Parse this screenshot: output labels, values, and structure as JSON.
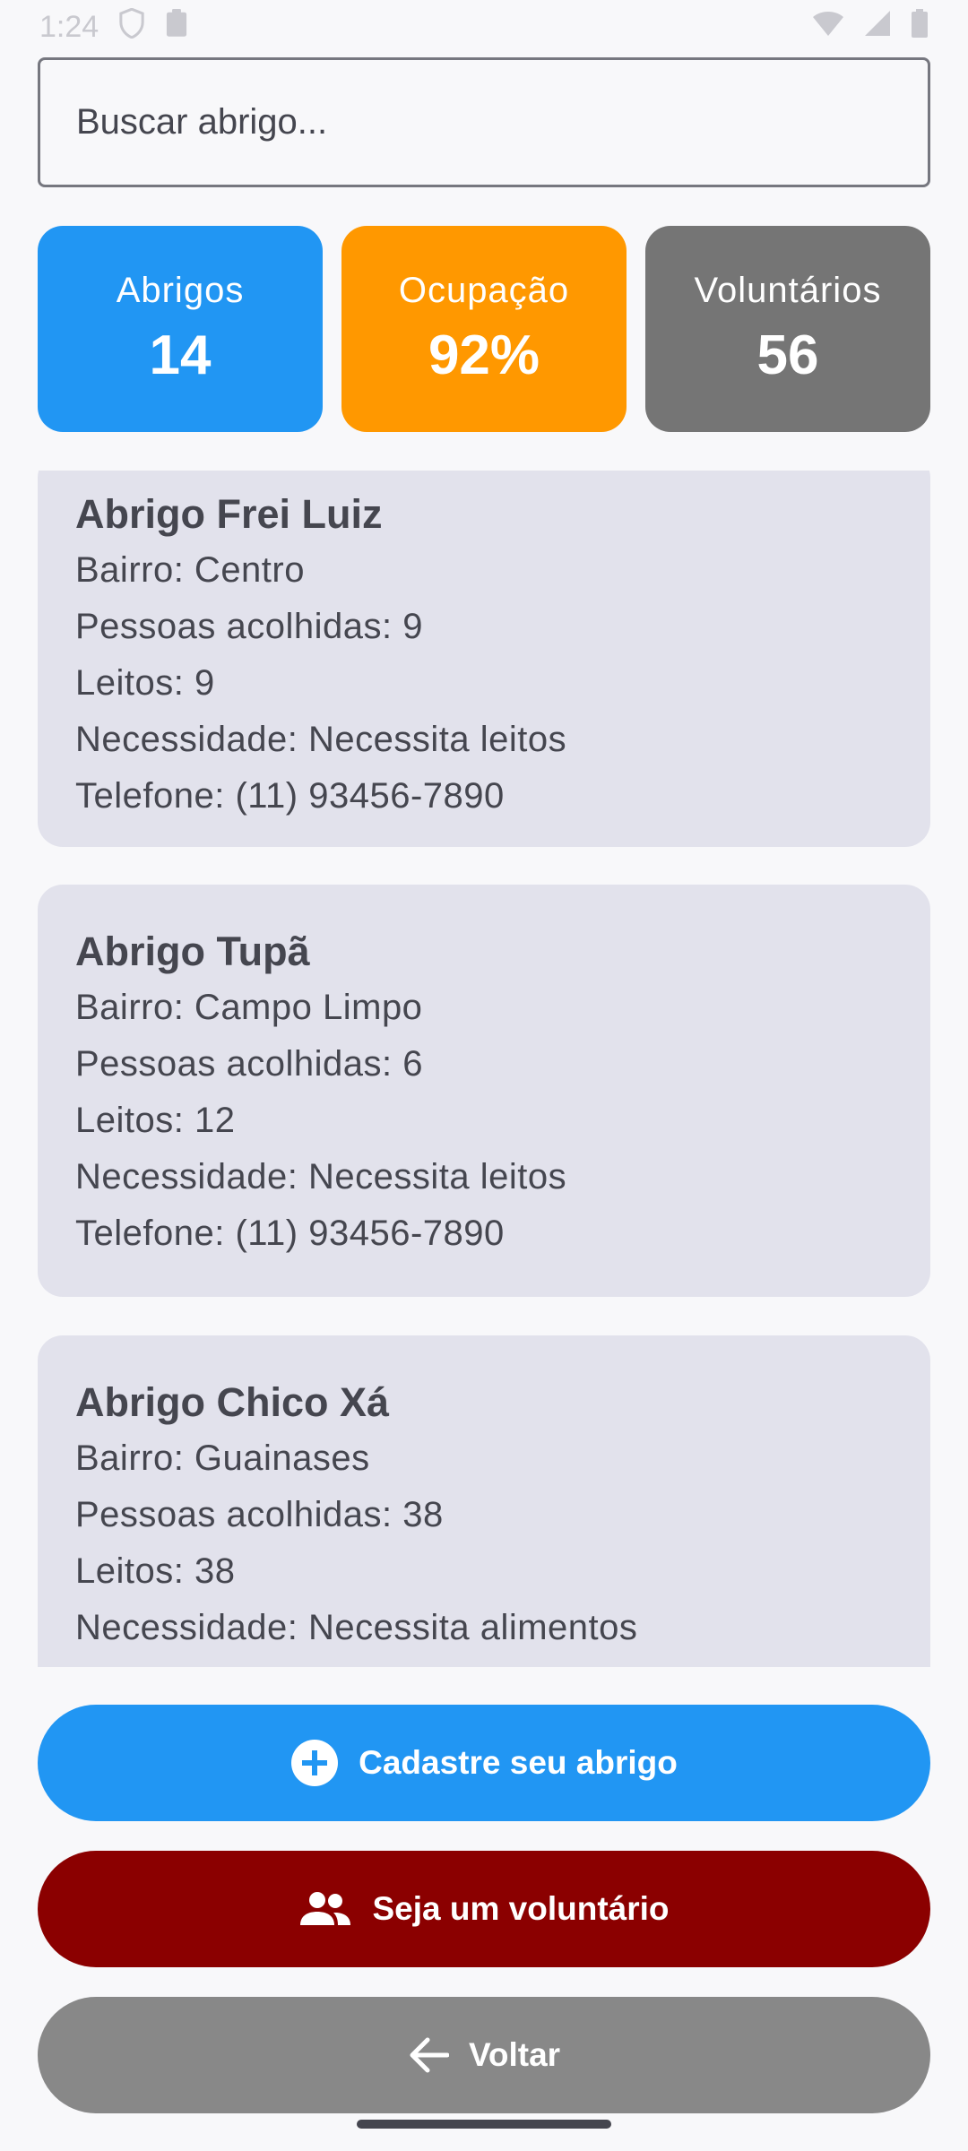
{
  "status": {
    "time": "1:24"
  },
  "search": {
    "placeholder": "Buscar abrigo..."
  },
  "stats": [
    {
      "label": "Abrigos",
      "value": "14",
      "color": "#2196f3"
    },
    {
      "label": "Ocupação",
      "value": "92%",
      "color": "#ff9800"
    },
    {
      "label": "Voluntários",
      "value": "56",
      "color": "#757575"
    }
  ],
  "shelters": [
    {
      "name": "Abrigo Frei Luiz",
      "bairro": "Bairro: Centro",
      "pessoas": "Pessoas acolhidas: 9",
      "leitos": "Leitos: 9",
      "necessidade": "Necessidade: Necessita leitos",
      "telefone": "Telefone: (11) 93456-7890"
    },
    {
      "name": "Abrigo Tupã",
      "bairro": "Bairro: Campo Limpo",
      "pessoas": "Pessoas acolhidas: 6",
      "leitos": "Leitos: 12",
      "necessidade": "Necessidade: Necessita leitos",
      "telefone": "Telefone: (11) 93456-7890"
    },
    {
      "name": "Abrigo Chico Xá",
      "bairro": "Bairro: Guainases",
      "pessoas": "Pessoas acolhidas: 38",
      "leitos": "Leitos: 38",
      "necessidade": "Necessidade: Necessita alimentos"
    }
  ],
  "buttons": {
    "register": {
      "label": "Cadastre seu abrigo",
      "icon": "add-circle-icon",
      "color": "#2196f3"
    },
    "volunteer": {
      "label": "Seja um voluntário",
      "icon": "group-icon",
      "color": "#8b0000"
    },
    "back": {
      "label": "Voltar",
      "icon": "arrow-back-icon",
      "color": "#888888"
    }
  }
}
